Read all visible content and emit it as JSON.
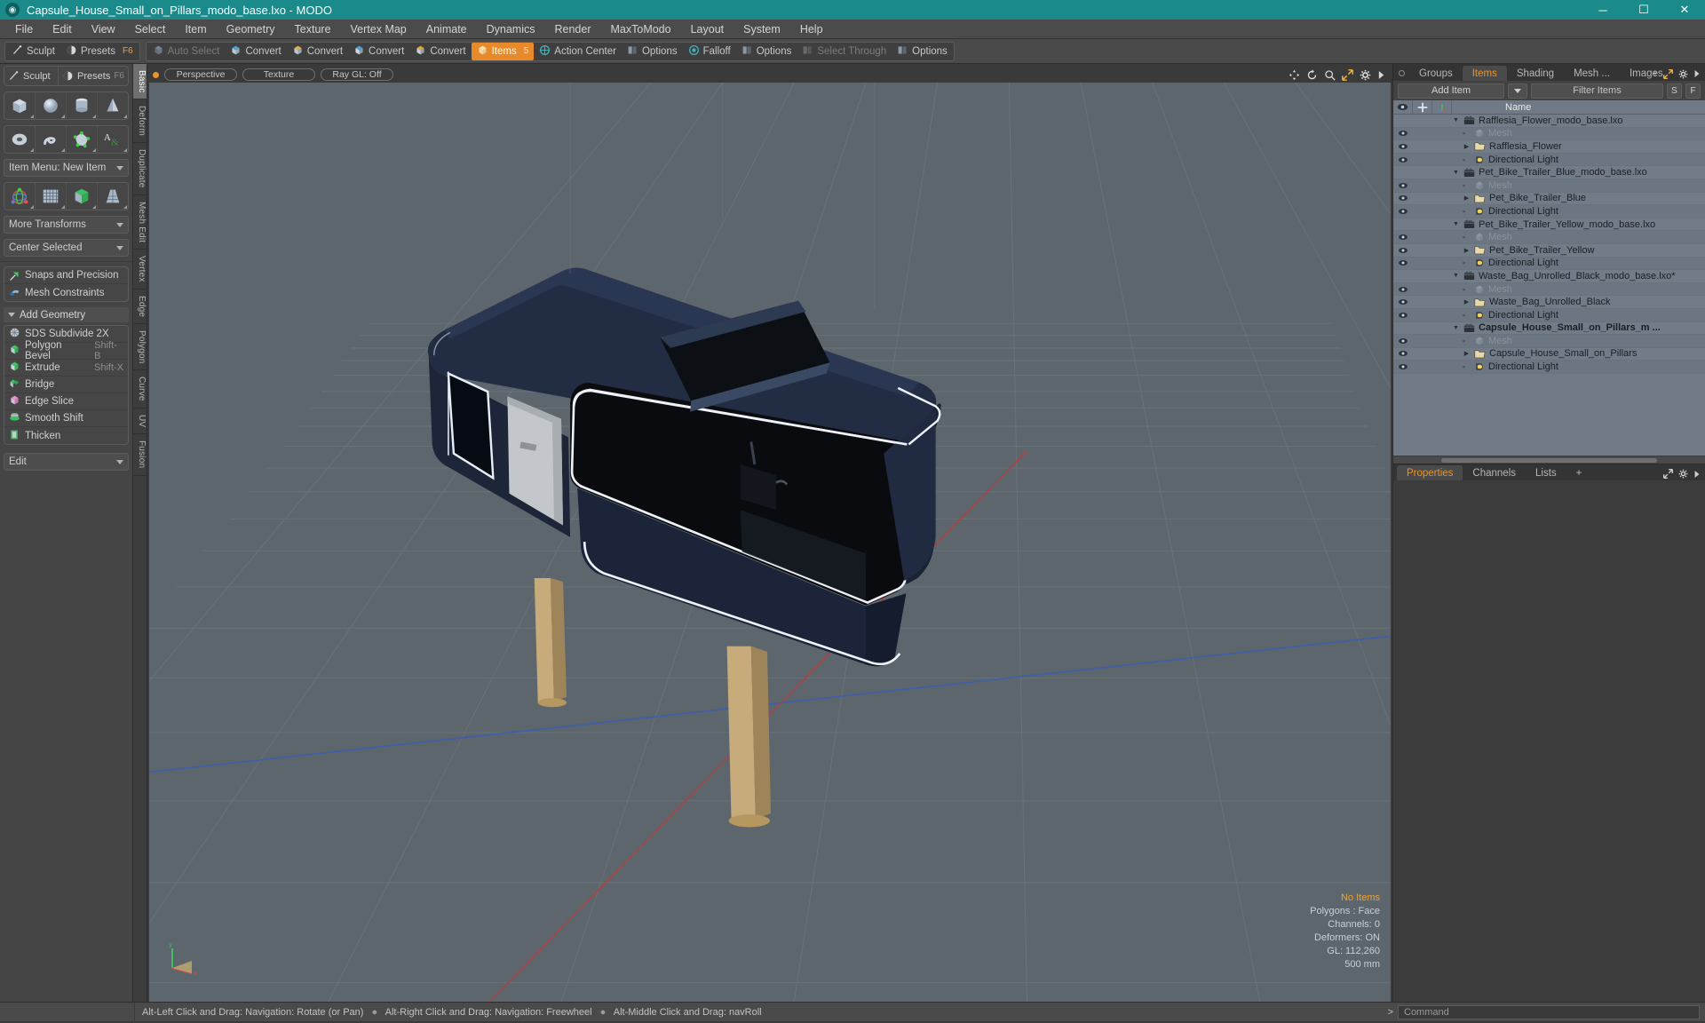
{
  "window": {
    "title": "Capsule_House_Small_on_Pillars_modo_base.lxo - MODO",
    "app_icon": "modo-logo-icon",
    "minimize": "─",
    "maximize": "☐",
    "close": "✕",
    "titlebar_color": "#1a8a8a"
  },
  "menu": {
    "items": [
      "File",
      "Edit",
      "View",
      "Select",
      "Item",
      "Geometry",
      "Texture",
      "Vertex Map",
      "Animate",
      "Dynamics",
      "Render",
      "MaxToModo",
      "Layout",
      "System",
      "Help"
    ]
  },
  "toolbar": {
    "groups": [
      {
        "buttons": [
          {
            "label": "Sculpt",
            "icon": "sculpt-icon",
            "state": "normal",
            "shortcut": ""
          },
          {
            "label": "Presets",
            "icon": "presets-icon",
            "state": "normal",
            "shortcut": "F6"
          }
        ]
      },
      {
        "buttons": [
          {
            "label": "Auto Select",
            "icon": "auto-select-icon",
            "state": "dim",
            "shortcut": ""
          },
          {
            "label": "Convert",
            "icon": "convert-vertex-icon",
            "state": "normal",
            "shortcut": ""
          },
          {
            "label": "Convert",
            "icon": "convert-edge-icon",
            "state": "normal",
            "shortcut": ""
          },
          {
            "label": "Convert",
            "icon": "convert-polygon-icon",
            "state": "normal",
            "shortcut": ""
          },
          {
            "label": "Convert",
            "icon": "convert-material-icon",
            "state": "normal",
            "shortcut": ""
          },
          {
            "label": "Items",
            "icon": "items-icon",
            "state": "active",
            "shortcut": "5"
          },
          {
            "label": "Action Center",
            "icon": "action-center-icon",
            "state": "normal",
            "shortcut": ""
          },
          {
            "label": "Options",
            "icon": "options-icon",
            "state": "normal",
            "shortcut": ""
          },
          {
            "label": "Falloff",
            "icon": "falloff-icon",
            "state": "normal",
            "shortcut": ""
          },
          {
            "label": "Options",
            "icon": "options-icon",
            "state": "normal",
            "shortcut": ""
          },
          {
            "label": "Select Through",
            "icon": "select-through-icon",
            "state": "dim",
            "shortcut": ""
          },
          {
            "label": "Options",
            "icon": "options-icon",
            "state": "normal",
            "shortcut": ""
          }
        ]
      }
    ]
  },
  "left_panel": {
    "top_row": [
      {
        "label": "Sculpt",
        "icon": "sculpt-icon"
      },
      {
        "label": "Presets",
        "icon": "presets-icon",
        "shortcut": "F6"
      }
    ],
    "primitive_icons_row1": [
      "cube-icon",
      "sphere-icon",
      "cylinder-icon",
      "cone-icon"
    ],
    "primitive_icons_row2": [
      "torus-icon",
      "spiral-icon",
      "polygon-pen-icon",
      "text-tool-icon"
    ],
    "item_menu": {
      "label": "Item Menu: New Item"
    },
    "transform_icons": [
      "transform-gizmo-icon",
      "bend-icon",
      "deform-icon",
      "taper-icon"
    ],
    "more_transforms": {
      "label": "More Transforms"
    },
    "center_selected": {
      "label": "Center Selected"
    },
    "snaps": {
      "label": "Snaps and Precision",
      "icon": "snap-arrow-icon"
    },
    "mesh_constraints": {
      "label": "Mesh Constraints",
      "icon": "mesh-constraint-icon"
    },
    "add_geometry_header": {
      "label": "Add Geometry"
    },
    "geometry_items": [
      {
        "label": "SDS Subdivide 2X",
        "shortcut": "",
        "icon": "sds-subdivide-icon"
      },
      {
        "label": "Polygon Bevel",
        "shortcut": "Shift-B",
        "icon": "polygon-bevel-icon"
      },
      {
        "label": "Extrude",
        "shortcut": "Shift-X",
        "icon": "extrude-icon"
      },
      {
        "label": "Bridge",
        "shortcut": "",
        "icon": "bridge-icon"
      },
      {
        "label": "Edge Slice",
        "shortcut": "",
        "icon": "edge-slice-icon"
      },
      {
        "label": "Smooth Shift",
        "shortcut": "",
        "icon": "smooth-shift-icon"
      },
      {
        "label": "Thicken",
        "shortcut": "",
        "icon": "thicken-icon"
      }
    ],
    "edit_dropdown": {
      "label": "Edit"
    }
  },
  "vertical_tabs": [
    {
      "label": "Basic",
      "selected": true
    },
    {
      "label": "Deform",
      "selected": false
    },
    {
      "label": "Duplicate",
      "selected": false
    },
    {
      "label": "Mesh Edit",
      "selected": false
    },
    {
      "label": "Vertex",
      "selected": false
    },
    {
      "label": "Edge",
      "selected": false
    },
    {
      "label": "Polygon",
      "selected": false
    },
    {
      "label": "Curve",
      "selected": false
    },
    {
      "label": "UV",
      "selected": false
    },
    {
      "label": "Fusion",
      "selected": false
    }
  ],
  "viewport": {
    "pills": [
      "Perspective",
      "Texture",
      "Ray GL: Off"
    ],
    "icons": [
      "move-icon",
      "rotate-icon",
      "zoom-icon",
      "fit-icon",
      "gear-icon",
      "chevron-right-icon"
    ],
    "stats": {
      "no_items": "No Items",
      "polygons": "Polygons : Face",
      "channels": "Channels: 0",
      "deformers": "Deformers: ON",
      "gl": "GL: 112,260",
      "grid": "500 mm"
    },
    "axis_labels": {
      "y": "y",
      "x": "x"
    },
    "bg_color": "#5d666d",
    "model_color": "#1b2437",
    "glass_color": "#070708",
    "pillar_color": "#c5ab7d"
  },
  "right_panel": {
    "tabs": [
      {
        "label": "Groups",
        "selected": false
      },
      {
        "label": "Items",
        "selected": true
      },
      {
        "label": "Shading",
        "selected": false
      },
      {
        "label": "Mesh ...",
        "selected": false
      },
      {
        "label": "Images",
        "selected": false
      }
    ],
    "tab_icons": [
      "plus-icon",
      "expand-icon",
      "gear-icon",
      "chevron-right-icon"
    ],
    "add_item": {
      "label": "Add Item",
      "caret": "chevron-down-icon"
    },
    "filter": {
      "placeholder": "Filter Items",
      "value": "Filter Items"
    },
    "filter_buttons": [
      "S",
      "F"
    ],
    "columns": {
      "eye": "eye-icon",
      "lock": "move-lock-icon",
      "axis": "axis-icon",
      "name": "Name"
    },
    "tree": [
      {
        "label": "Rafflesia_Flower_modo_base.lxo",
        "depth": 0,
        "type": "scene",
        "icon": "scene-icon",
        "twirl": "down",
        "eye": false,
        "dim": false,
        "bold": false
      },
      {
        "label": "Mesh",
        "depth": 1,
        "type": "mesh",
        "icon": "mesh-icon",
        "twirl": "none",
        "eye": true,
        "dim": true,
        "bold": false
      },
      {
        "label": "Rafflesia_Flower",
        "depth": 1,
        "type": "group",
        "icon": "folder-icon",
        "twirl": "right",
        "eye": true,
        "dim": false,
        "bold": false
      },
      {
        "label": "Directional Light",
        "depth": 1,
        "type": "light",
        "icon": "light-icon",
        "twirl": "none",
        "eye": true,
        "dim": false,
        "bold": false
      },
      {
        "label": "Pet_Bike_Trailer_Blue_modo_base.lxo",
        "depth": 0,
        "type": "scene",
        "icon": "scene-icon",
        "twirl": "down",
        "eye": false,
        "dim": false,
        "bold": false
      },
      {
        "label": "Mesh",
        "depth": 1,
        "type": "mesh",
        "icon": "mesh-icon",
        "twirl": "none",
        "eye": true,
        "dim": true,
        "bold": false
      },
      {
        "label": "Pet_Bike_Trailer_Blue",
        "depth": 1,
        "type": "group",
        "icon": "folder-icon",
        "twirl": "right",
        "eye": true,
        "dim": false,
        "bold": false
      },
      {
        "label": "Directional Light",
        "depth": 1,
        "type": "light",
        "icon": "light-icon",
        "twirl": "none",
        "eye": true,
        "dim": false,
        "bold": false
      },
      {
        "label": "Pet_Bike_Trailer_Yellow_modo_base.lxo",
        "depth": 0,
        "type": "scene",
        "icon": "scene-icon",
        "twirl": "down",
        "eye": false,
        "dim": false,
        "bold": false
      },
      {
        "label": "Mesh",
        "depth": 1,
        "type": "mesh",
        "icon": "mesh-icon",
        "twirl": "none",
        "eye": true,
        "dim": true,
        "bold": false
      },
      {
        "label": "Pet_Bike_Trailer_Yellow",
        "depth": 1,
        "type": "group",
        "icon": "folder-icon",
        "twirl": "right",
        "eye": true,
        "dim": false,
        "bold": false
      },
      {
        "label": "Directional Light",
        "depth": 1,
        "type": "light",
        "icon": "light-icon",
        "twirl": "none",
        "eye": true,
        "dim": false,
        "bold": false
      },
      {
        "label": "Waste_Bag_Unrolled_Black_modo_base.lxo*",
        "depth": 0,
        "type": "scene",
        "icon": "scene-icon",
        "twirl": "down",
        "eye": false,
        "dim": false,
        "bold": false
      },
      {
        "label": "Mesh",
        "depth": 1,
        "type": "mesh",
        "icon": "mesh-icon",
        "twirl": "none",
        "eye": true,
        "dim": true,
        "bold": false
      },
      {
        "label": "Waste_Bag_Unrolled_Black",
        "depth": 1,
        "type": "group",
        "icon": "folder-icon",
        "twirl": "right",
        "eye": true,
        "dim": false,
        "bold": false
      },
      {
        "label": "Directional Light",
        "depth": 1,
        "type": "light",
        "icon": "light-icon",
        "twirl": "none",
        "eye": true,
        "dim": false,
        "bold": false
      },
      {
        "label": "Capsule_House_Small_on_Pillars_m ...",
        "depth": 0,
        "type": "scene",
        "icon": "scene-icon",
        "twirl": "down",
        "eye": false,
        "dim": false,
        "bold": true
      },
      {
        "label": "Mesh",
        "depth": 1,
        "type": "mesh",
        "icon": "mesh-icon",
        "twirl": "none",
        "eye": true,
        "dim": true,
        "bold": false
      },
      {
        "label": "Capsule_House_Small_on_Pillars",
        "depth": 1,
        "type": "group",
        "icon": "folder-icon",
        "twirl": "right",
        "eye": true,
        "dim": false,
        "bold": false
      },
      {
        "label": "Directional Light",
        "depth": 1,
        "type": "light",
        "icon": "light-icon",
        "twirl": "none",
        "eye": true,
        "dim": false,
        "bold": false
      }
    ],
    "bottom_tabs": [
      {
        "label": "Properties",
        "selected": true
      },
      {
        "label": "Channels",
        "selected": false
      },
      {
        "label": "Lists",
        "selected": false
      },
      {
        "label": "+",
        "selected": false
      }
    ]
  },
  "statusbar": {
    "hints": [
      "Alt-Left Click and Drag: Navigation: Rotate (or Pan)",
      "Alt-Right Click and Drag: Navigation: Freewheel",
      "Alt-Middle Click and Drag: navRoll"
    ],
    "separator": "●",
    "command_placeholder": "Command",
    "command_prompt": ">"
  }
}
